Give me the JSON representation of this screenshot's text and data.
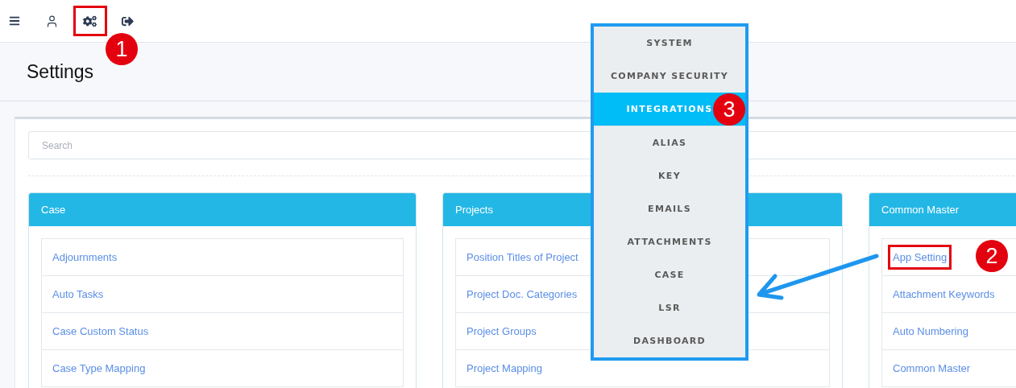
{
  "toolbar": [
    {
      "kind": "menu",
      "highlighted": false
    },
    {
      "kind": "user",
      "highlighted": false
    },
    {
      "kind": "settings",
      "highlighted": true,
      "callout": "1"
    },
    {
      "kind": "logout",
      "highlighted": false
    }
  ],
  "page_title": "Settings",
  "search": {
    "placeholder": "Search"
  },
  "cards": [
    {
      "title": "Case",
      "items": [
        {
          "label": "Adjournments",
          "highlighted": false
        },
        {
          "label": "Auto Tasks",
          "highlighted": false
        },
        {
          "label": "Case Custom Status",
          "highlighted": false
        },
        {
          "label": "Case Type Mapping",
          "highlighted": false
        }
      ]
    },
    {
      "title": "Projects",
      "items": [
        {
          "label": "Position Titles of Project",
          "highlighted": false
        },
        {
          "label": "Project Doc. Categories",
          "highlighted": false
        },
        {
          "label": "Project Groups",
          "highlighted": false
        },
        {
          "label": "Project Mapping",
          "highlighted": false
        }
      ]
    },
    {
      "title": "Common Master",
      "items": [
        {
          "label": "App Setting",
          "highlighted": true,
          "callout": "2"
        },
        {
          "label": "Attachment Keywords",
          "highlighted": false
        },
        {
          "label": "Auto Numbering",
          "highlighted": false
        },
        {
          "label": "Common Master",
          "highlighted": false
        }
      ]
    }
  ],
  "menu": [
    {
      "label": "SYSTEM",
      "selected": false
    },
    {
      "label": "COMPANY SECURITY",
      "selected": false
    },
    {
      "label": "INTEGRATIONS",
      "selected": true,
      "callout": "3"
    },
    {
      "label": "ALIAS",
      "selected": false
    },
    {
      "label": "KEY",
      "selected": false
    },
    {
      "label": "EMAILS",
      "selected": false
    },
    {
      "label": "ATTACHMENTS",
      "selected": false
    },
    {
      "label": "CASE",
      "selected": false
    },
    {
      "label": "LSR",
      "selected": false
    },
    {
      "label": "DASHBOARD",
      "selected": false
    }
  ]
}
